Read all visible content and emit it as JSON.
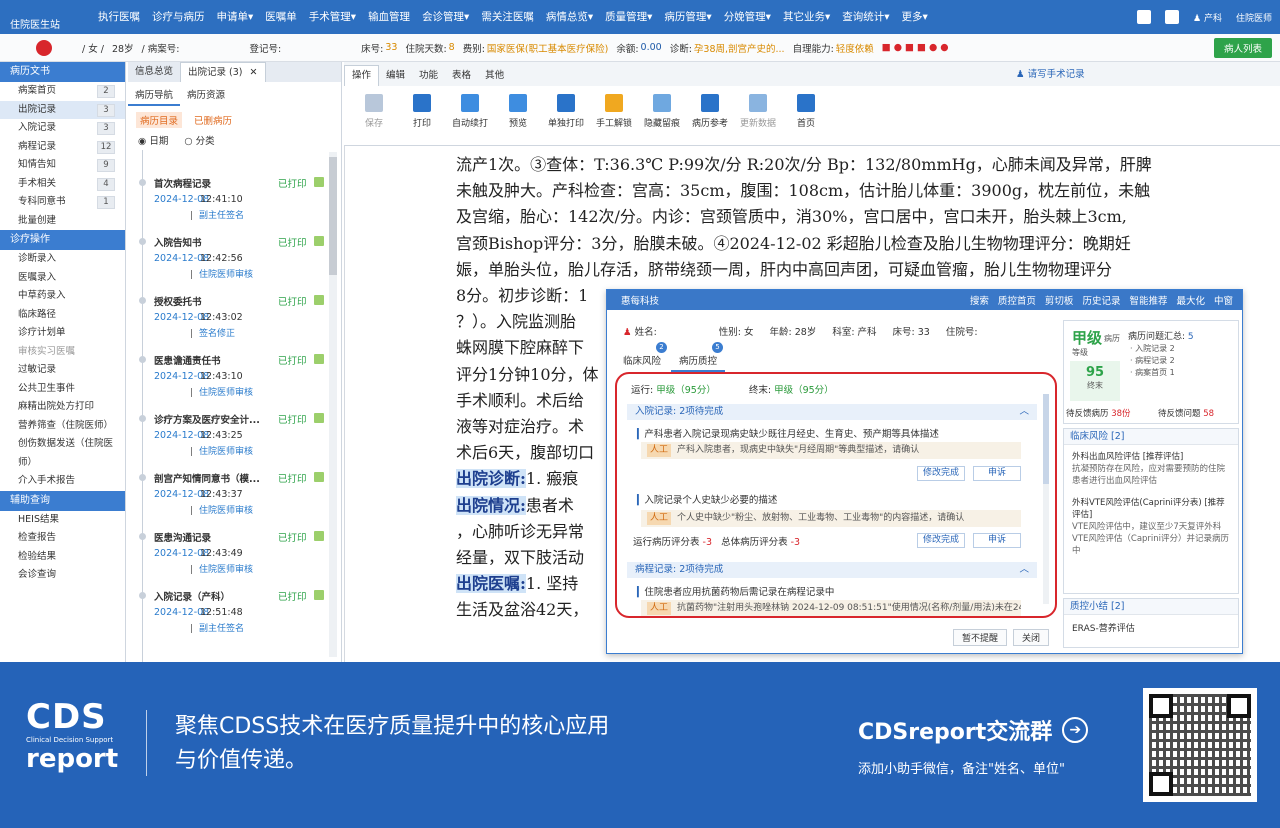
{
  "app": {
    "logo": "住院医生站",
    "menu": [
      "执行医嘱",
      "诊疗与病历",
      "申请单▾",
      "医嘱单",
      "手术管理▾",
      "输血管理",
      "会诊管理▾",
      "需关注医嘱",
      "病情总览▾",
      "质量管理▾",
      "病历管理▾",
      "分娩管理▾",
      "其它业务▾",
      "查询统计▾",
      "更多▾"
    ],
    "user_label": "住院医师",
    "dept_label": "产科"
  },
  "patient_bar": {
    "gender_age": "/ 女 /",
    "age": "28岁",
    "case_no_label": "/ 病案号:",
    "reg_label": "登记号:",
    "bed_label": "床号:",
    "bed": "33",
    "days_label": "住院天数:",
    "days": "8",
    "fee_label": "费别:",
    "fee": "国家医保(职工基本医疗保险)",
    "balance_label": "余额:",
    "balance": "0.00",
    "diag_label": "诊断:",
    "diag": "孕38周,剖宫产史的...",
    "self_label": "自理能力:",
    "self": "轻度依赖",
    "patient_list_btn": "病人列表"
  },
  "sidebar": {
    "sections": [
      {
        "title": "病历文书",
        "items": [
          {
            "label": "病案首页",
            "count": "2"
          },
          {
            "label": "出院记录",
            "count": "3",
            "active": true
          },
          {
            "label": "入院记录",
            "count": "3"
          },
          {
            "label": "病程记录",
            "count": "12"
          },
          {
            "label": "知情告知",
            "count": "9"
          },
          {
            "label": "手术相关",
            "count": "4"
          },
          {
            "label": "专科同意书",
            "count": "1"
          },
          {
            "label": "批量创建",
            "count": ""
          }
        ]
      },
      {
        "title": "诊疗操作",
        "items": [
          {
            "label": "诊断录入"
          },
          {
            "label": "医嘱录入"
          },
          {
            "label": "中草药录入"
          },
          {
            "label": "临床路径"
          },
          {
            "label": "诊疗计划单"
          },
          {
            "label": "审核实习医嘱",
            "gray": true
          },
          {
            "label": "过敏记录"
          },
          {
            "label": "公共卫生事件"
          },
          {
            "label": "麻精出院处方打印"
          },
          {
            "label": "营养筛查（住院医师）"
          },
          {
            "label": "创伤数据发送（住院医"
          },
          {
            "label": "师）"
          },
          {
            "label": "介入手术报告"
          }
        ]
      },
      {
        "title": "辅助查询",
        "items": [
          {
            "label": "HEIS结果"
          },
          {
            "label": "检查报告"
          },
          {
            "label": "检验结果"
          },
          {
            "label": "会诊查询"
          }
        ]
      }
    ]
  },
  "doc_panel": {
    "tab1": "信息总览",
    "tab2": "出院记录 (3)",
    "close": "✕",
    "nav_tab": "病历导航",
    "res_tab": "病历资源",
    "list_tab": "病历目录",
    "deleted_tab": "已删病历",
    "radio_date": "日期",
    "radio_cat": "分类",
    "records": [
      {
        "title": "首次病程记录",
        "status": "已打印",
        "date": "2024-12-08",
        "time": "12:41:10",
        "sign": "副主任签名"
      },
      {
        "title": "入院告知书",
        "status": "已打印",
        "date": "2024-12-08",
        "time": "12:42:56",
        "sign": "住院医师审核"
      },
      {
        "title": "授权委托书",
        "status": "已打印",
        "date": "2024-12-08",
        "time": "12:43:02",
        "sign": "签名修正"
      },
      {
        "title": "医患谵通责任书",
        "status": "已打印",
        "date": "2024-12-08",
        "time": "12:43:10",
        "sign": "住院医师审核"
      },
      {
        "title": "诊疗方案及医疗安全计...",
        "status": "已打印",
        "date": "2024-12-08",
        "time": "12:43:25",
        "sign": "住院医师审核"
      },
      {
        "title": "剖宫产知情同意书（模...",
        "status": "已打印",
        "date": "2024-12-08",
        "time": "12:43:37",
        "sign": "住院医师审核"
      },
      {
        "title": "医患沟通记录",
        "status": "已打印",
        "date": "2024-12-08",
        "time": "12:43:49",
        "sign": "住院医师审核"
      },
      {
        "title": "入院记录（产科）",
        "status": "已打印",
        "date": "2024-12-08",
        "time": "12:51:48",
        "sign": "副主任签名"
      }
    ]
  },
  "editor": {
    "tabs": [
      "操作",
      "编辑",
      "功能",
      "表格",
      "其他"
    ],
    "handwrite": "请写手术记录",
    "tools": [
      {
        "label": "保存",
        "color": "#b8c7da",
        "dis": true
      },
      {
        "label": "打印",
        "color": "#2a73c9"
      },
      {
        "label": "自动续打",
        "color": "#3e8de0"
      },
      {
        "label": "预览",
        "color": "#3e8de0"
      },
      {
        "label": "单独打印",
        "color": "#2a73c9"
      },
      {
        "label": "手工解锁",
        "color": "#f0a820"
      },
      {
        "label": "隐藏留痕",
        "color": "#6fa8e0"
      },
      {
        "label": "病历参考",
        "color": "#2a73c9"
      },
      {
        "label": "更新数据",
        "color": "#8ab4e0",
        "dis": true
      },
      {
        "label": "首页",
        "color": "#2a73c9"
      }
    ],
    "lines": [
      "流产1次。③查体：T:36.3℃ P:99次/分 R:20次/分 Bp：132/80mmHg，心肺未闻及异常，肝脾",
      "未触及肿大。产科检查：宫高：35cm，腹围：108cm，估计胎儿体重：3900g，枕左前位，未触",
      "及宫缩，胎心：142次/分。内诊：宫颈管质中，消30%，宫口居中，宫口未开，胎头棘上3cm,",
      "宫颈Bishop评分：3分，胎膜未破。④2024-12-02 彩超胎儿检查及胎儿生物物理评分：晚期妊",
      "娠，单胎头位，胎儿存活，脐带绕颈一周，肝内中高回声团，可疑血管瘤，胎儿生物物理评分",
      "8分。初步诊断：1",
      "？）。入院监测胎",
      "蛛网膜下腔麻醉下",
      "评分1分钟10分，体",
      "手术顺利。术后给",
      "液等对症治疗。术",
      "术后6天，腹部切口"
    ],
    "hl_lines": [
      {
        "key": "出院诊断:",
        "rest": "1. 瘢痕"
      },
      {
        "key": "出院情况:",
        "rest": "患者术"
      },
      {
        "key": "",
        "rest": "，心肺听诊无异常"
      },
      {
        "key": "",
        "rest": "经量，双下肢活动"
      },
      {
        "key": "出院医嘱:",
        "rest": "1. 坚持"
      },
      {
        "key": "",
        "rest": "生活及盆浴42天，"
      }
    ]
  },
  "qc_dialog": {
    "title": "惠每科技",
    "actions": [
      "搜索",
      "质控首页",
      "剪切板",
      "历史记录",
      "智能推荐",
      "最大化",
      "中窗"
    ],
    "name_label": "姓名:",
    "gender": "性别: 女",
    "age": "年龄: 28岁",
    "dept": "科室: 产科",
    "bed": "床号: 33",
    "inpatient_no": "住院号:",
    "tab_risk": "临床风险",
    "tab_risk_badge": "2",
    "tab_qc": "病历质控",
    "tab_qc_badge": "5",
    "run_label": "运行:",
    "run_grade": "甲级（95分）",
    "final_label": "终末:",
    "final_grade": "甲级（95分）",
    "sec1": "入院记录: 2项待完成",
    "item1": "产科患者入院记录现病史缺少既往月经史、生育史、预产期等具体描述",
    "note_tag": "人工",
    "note1": "产科入院患者，现病史中缺失\"月经周期\"等典型描述，请确认",
    "fix_btn": "修改完成",
    "appeal_btn": "申诉",
    "item2": "入院记录个人史缺少必要的描述",
    "note2": "个人史中缺少\"粉尘、放射物、工业毒物、工业毒物\"的内容描述，请确认",
    "score_run": "运行病历评分表",
    "score_run_v": "-3",
    "score_total": "总体病历评分表",
    "score_total_v": "-3",
    "sec2": "病程记录: 2项待完成",
    "item3": "住院患者应用抗菌药物后需记录在病程记录中",
    "note3": "抗菌药物\"注射用头孢唑林钠 2024-12-09 08:51:51\"使用情况(名称/剂量/用法)未在24",
    "btn_no_remind": "暂不提醒",
    "btn_close": "关闭",
    "grade": "甲级",
    "grade_sub": "病历",
    "grade_level": "等级",
    "score": "95",
    "score_sub": "终末",
    "summary_title": "病历问题汇总:",
    "summary_count": "5",
    "summary_items": [
      "· 入院记录 2",
      "· 病程记录 2",
      "· 病案首页 1"
    ],
    "pending_label": "待反馈病历",
    "pending_v": "38份",
    "pending_q": "待反馈问题",
    "pending_q_v": "58",
    "risk_title": "临床风险 [2]",
    "risk1_title": "外科出血风险评估 [推荐评估]",
    "risk1_text": "抗凝预防存在风险，应对需要预防的住院患者进行出血风险评估",
    "risk2_title": "外科VTE风险评估(Caprini评分表) [推荐评估]",
    "risk2_text": "VTE风险评估中，建议至少7天复评外科VTE风险评估（Caprini评分）并记录病历中",
    "qc_summary_title": "质控小结 [2]",
    "qc_summary_item": "ERAS-营养评估"
  },
  "banner": {
    "logo_top": "CDS",
    "logo_mid": "Clinical Decision Support",
    "logo_bot": "report",
    "slogan1": "聚焦CDSS技术在医疗质量提升中的核心应用",
    "slogan2": "与价值传递。",
    "group": "CDSreport交流群",
    "group_sub": "添加小助手微信，备注\"姓名、单位\"",
    "arrow": "➔"
  }
}
